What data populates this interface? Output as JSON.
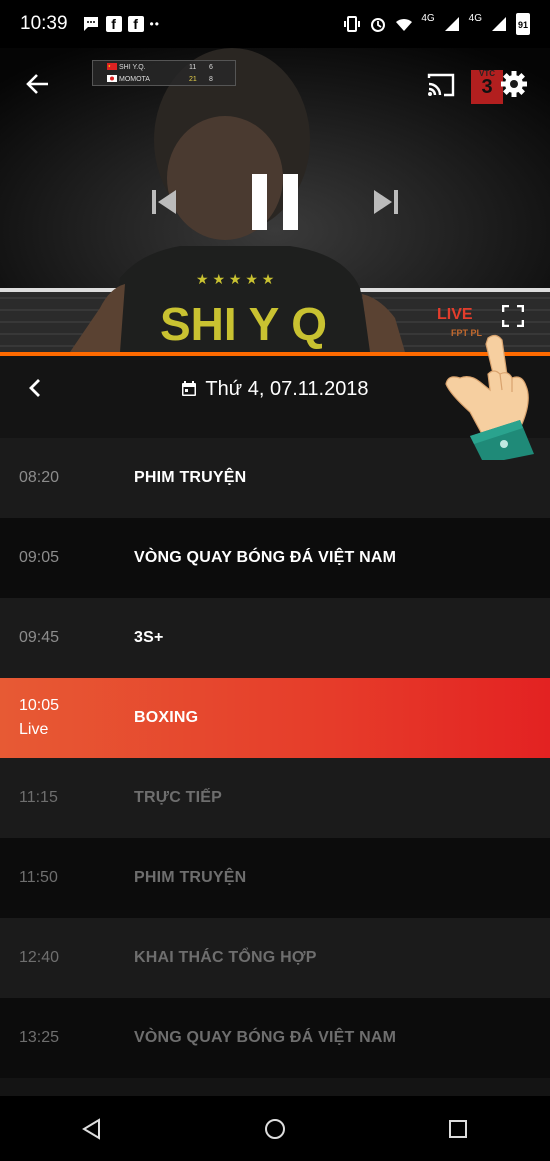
{
  "status_bar": {
    "time": "10:39",
    "network_1": "4G",
    "network_2": "4G",
    "battery": "91"
  },
  "player": {
    "scoreboard": {
      "player1_name": "SHI Y.Q.",
      "player1_game": "11",
      "player1_set": "6",
      "player2_name": "MOMOTA",
      "player2_game": "21",
      "player2_set": "8"
    },
    "channel_logo_top": "VTC",
    "channel_logo_num": "3",
    "jersey_text": "SHI Y Q",
    "live_label": "LIVE",
    "watermark": "FPT PL",
    "accent_color": "#ff6a00"
  },
  "date_bar": {
    "date_text": "Thứ 4, 07.11.2018"
  },
  "schedule": [
    {
      "time": "08:20",
      "sub": "",
      "title": "PHIM TRUYỆN",
      "state": "past"
    },
    {
      "time": "09:05",
      "sub": "",
      "title": "VÒNG QUAY BÓNG ĐÁ VIỆT NAM",
      "state": "past"
    },
    {
      "time": "09:45",
      "sub": "",
      "title": "3S+",
      "state": "past"
    },
    {
      "time": "10:05",
      "sub": "Live",
      "title": "BOXING",
      "state": "live"
    },
    {
      "time": "11:15",
      "sub": "",
      "title": "TRỰC TIẾP",
      "state": "future"
    },
    {
      "time": "11:50",
      "sub": "",
      "title": "PHIM TRUYỆN",
      "state": "future"
    },
    {
      "time": "12:40",
      "sub": "",
      "title": "KHAI THÁC TỔNG HỢP",
      "state": "future"
    },
    {
      "time": "13:25",
      "sub": "",
      "title": "VÒNG QUAY BÓNG ĐÁ VIỆT NAM",
      "state": "future"
    }
  ]
}
